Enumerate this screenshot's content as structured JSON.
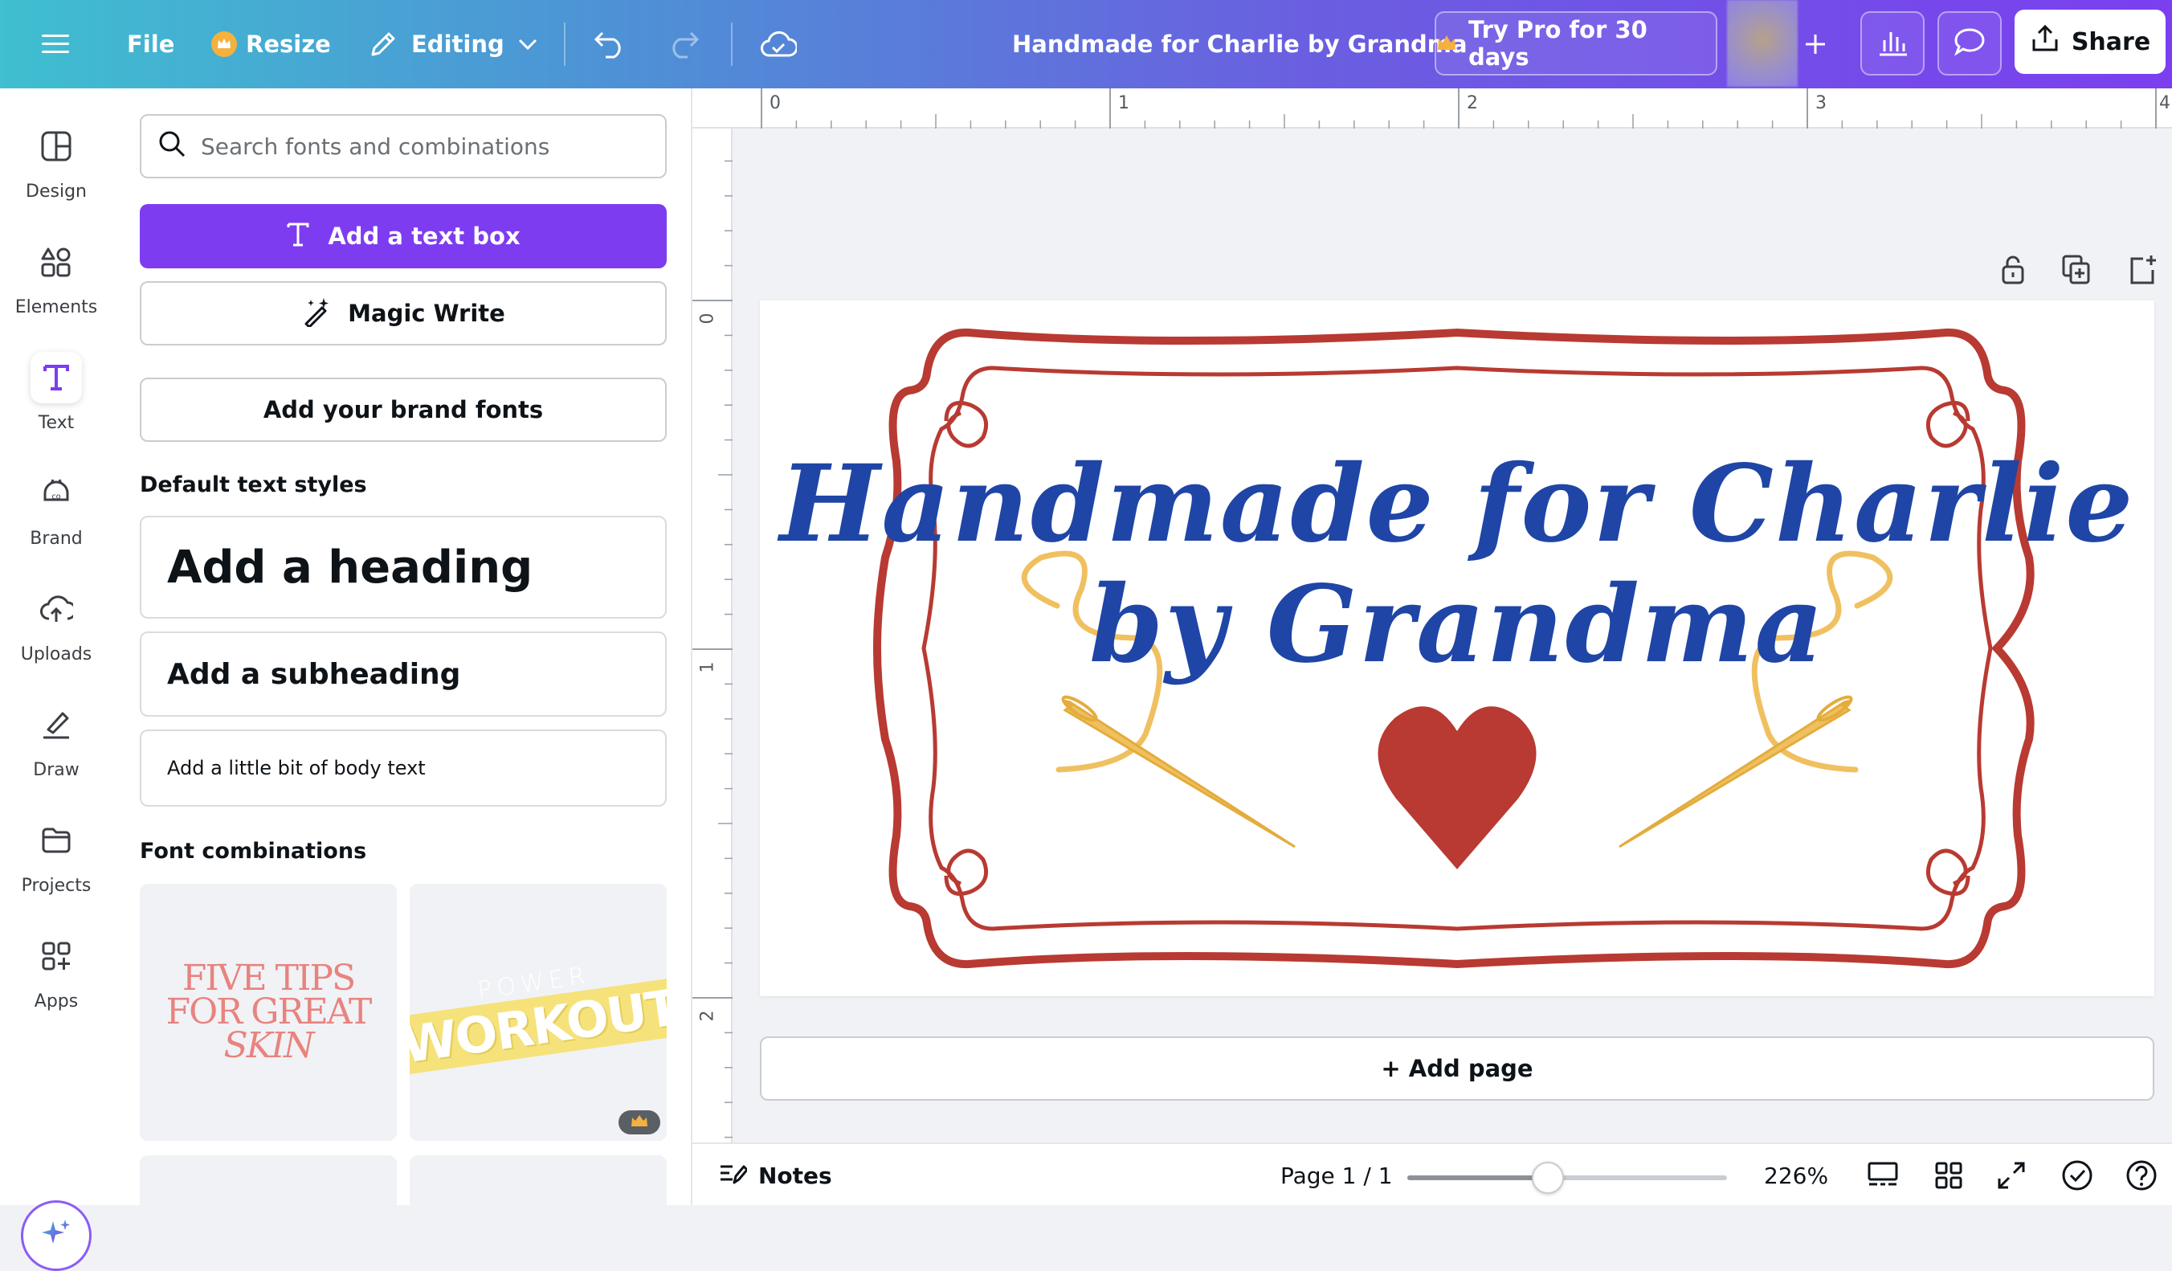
{
  "topbar": {
    "file_label": "File",
    "resize_label": "Resize",
    "mode_label": "Editing",
    "doc_title": "Handmade for Charlie by Grandma",
    "try_pro_label": "Try Pro for 30 days",
    "share_label": "Share"
  },
  "nav": {
    "items": [
      {
        "label": "Design",
        "icon": "design-icon"
      },
      {
        "label": "Elements",
        "icon": "elements-icon"
      },
      {
        "label": "Text",
        "icon": "text-icon"
      },
      {
        "label": "Brand",
        "icon": "brand-icon"
      },
      {
        "label": "Uploads",
        "icon": "uploads-icon"
      },
      {
        "label": "Draw",
        "icon": "draw-icon"
      },
      {
        "label": "Projects",
        "icon": "projects-icon"
      },
      {
        "label": "Apps",
        "icon": "apps-icon"
      }
    ],
    "active": "Text"
  },
  "panel": {
    "search_placeholder": "Search fonts and combinations",
    "add_textbox_label": "Add a text box",
    "magic_write_label": "Magic Write",
    "brand_fonts_label": "Add your brand fonts",
    "default_styles_title": "Default text styles",
    "heading_label": "Add a heading",
    "subheading_label": "Add a subheading",
    "body_label": "Add a little bit of body text",
    "combinations_title": "Font combinations",
    "combo1_lines": [
      "FIVE TIPS",
      "FOR GREAT",
      "SKIN"
    ],
    "combo2_small": "POWER",
    "combo2_big": "WORKOUT"
  },
  "ruler": {
    "top_marks": [
      "0",
      "1",
      "2",
      "3",
      "4"
    ],
    "left_marks": [
      "0",
      "1",
      "2"
    ]
  },
  "design": {
    "line1": "Handmade for Charlie",
    "line2": "by Grandma"
  },
  "canvas": {
    "add_page_label": "+ Add page"
  },
  "bottombar": {
    "notes_label": "Notes",
    "page_indicator": "Page 1 / 1",
    "zoom_label": "226%",
    "zoom_fraction": 0.44
  },
  "colors": {
    "primary_purple": "#7d3cf0",
    "frame_red": "#b83a32",
    "text_blue": "#1f45a6",
    "needle_gold": "#f0c060"
  }
}
